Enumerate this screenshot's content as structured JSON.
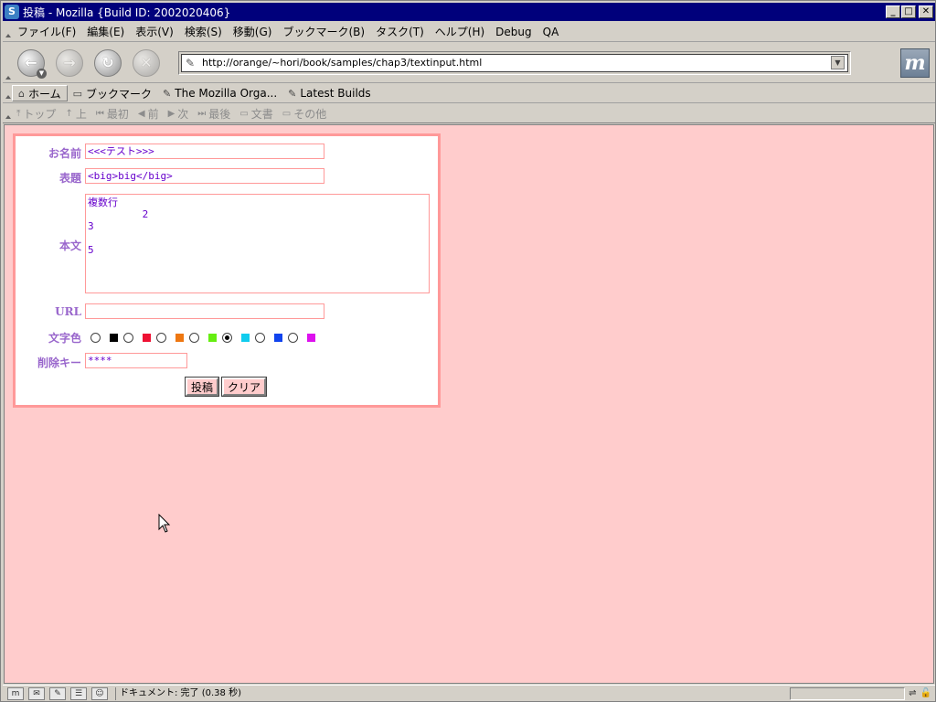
{
  "window": {
    "title": "投稿 - Mozilla {Build ID: 2002020406}",
    "buttons": {
      "minimize": "_",
      "maximize": "□",
      "close": "✕"
    }
  },
  "menubar": {
    "items": [
      "ファイル(F)",
      "編集(E)",
      "表示(V)",
      "検索(S)",
      "移動(G)",
      "ブックマーク(B)",
      "タスク(T)",
      "ヘルプ(H)",
      "Debug",
      "QA"
    ]
  },
  "navbar": {
    "url": "http://orange/~hori/book/samples/chap3/textinput.html",
    "throbber": "m"
  },
  "personal_toolbar": {
    "home": "ホーム",
    "bookmarks": "ブックマーク",
    "links": [
      "The Mozilla Orga...",
      "Latest Builds"
    ]
  },
  "site_nav": {
    "items": [
      "トップ",
      "上",
      "最初",
      "前",
      "次",
      "最後",
      "文書",
      "その他"
    ]
  },
  "form": {
    "name_label": "お名前",
    "name_value": "<<<テスト>>>",
    "subject_label": "表題",
    "subject_value": "<big>big</big>",
    "body_label": "本文",
    "body_value": "複数行\n         2\n3\n\n5",
    "url_label": "URL",
    "url_value": "",
    "color_label": "文字色",
    "colors": [
      "#000000",
      "#ee1133",
      "#ee7711",
      "#66ee11",
      "#11ccee",
      "#1144ee",
      "#dd11ee"
    ],
    "selected_color_index": 4,
    "delete_key_label": "削除キー",
    "delete_key_value": "****",
    "submit_label": "投稿",
    "clear_label": "クリア"
  },
  "statusbar": {
    "text": "ドキュメント: 完了 (0.38 秒)"
  }
}
